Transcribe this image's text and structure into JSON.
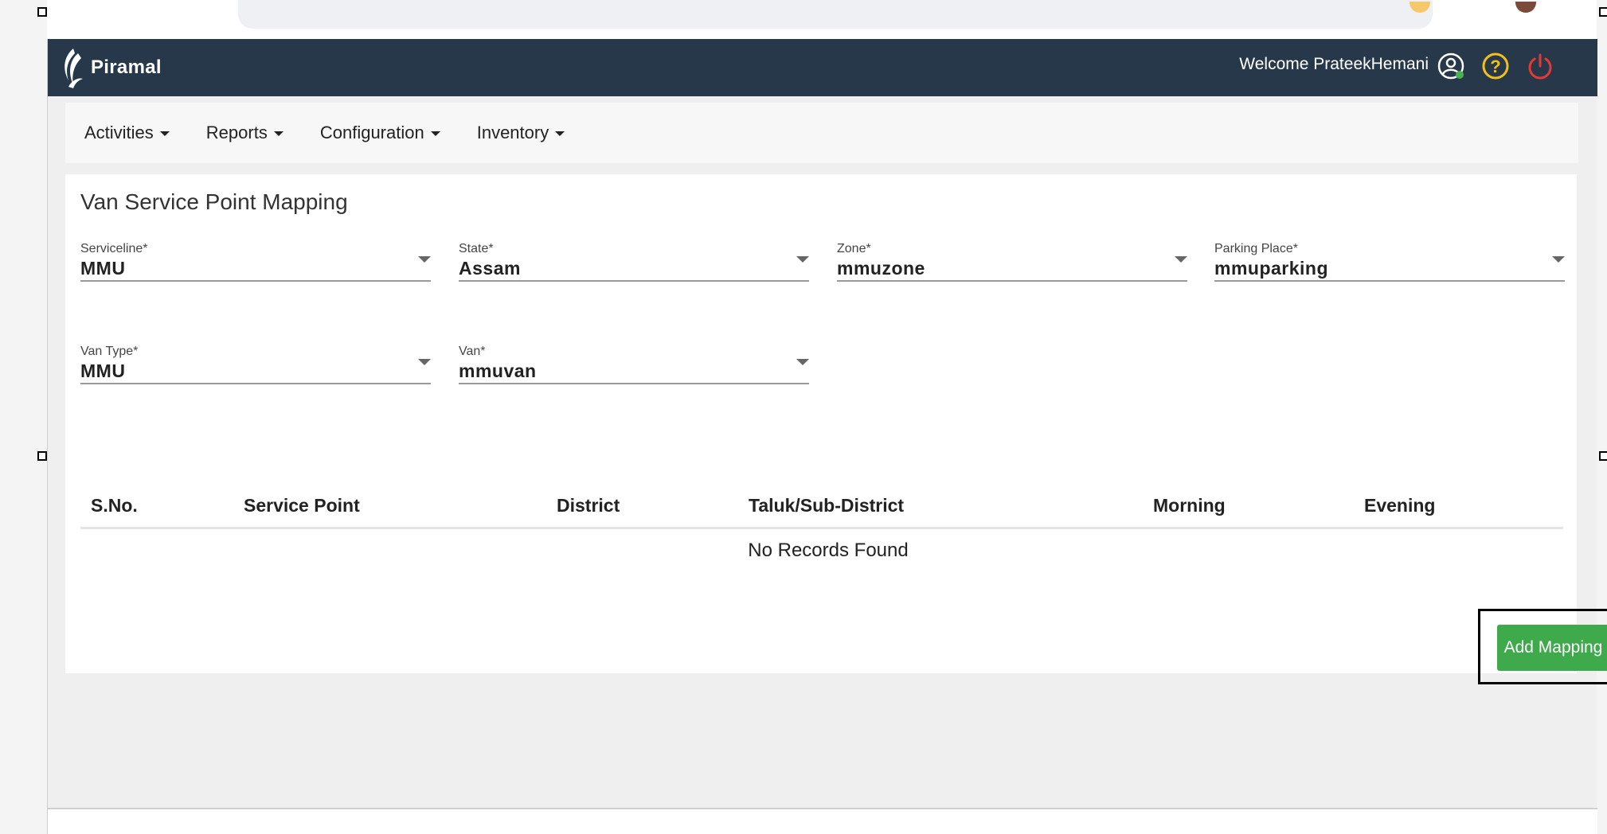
{
  "header": {
    "brand": "Piramal",
    "welcome": "Welcome PrateekHemani",
    "icons": [
      "user-circle-icon",
      "help-icon",
      "power-icon"
    ]
  },
  "menu": [
    {
      "label": "Activities"
    },
    {
      "label": "Reports"
    },
    {
      "label": "Configuration"
    },
    {
      "label": "Inventory"
    }
  ],
  "page": {
    "title": "Van Service Point Mapping"
  },
  "form": {
    "serviceline": {
      "label": "Serviceline*",
      "value": "MMU"
    },
    "state": {
      "label": "State*",
      "value": "Assam"
    },
    "zone": {
      "label": "Zone*",
      "value": "mmuzone"
    },
    "parking": {
      "label": "Parking Place*",
      "value": "mmuparking"
    },
    "van_type": {
      "label": "Van Type*",
      "value": "MMU"
    },
    "van": {
      "label": "Van*",
      "value": "mmuvan"
    }
  },
  "table": {
    "columns": [
      "S.No.",
      "Service Point",
      "District",
      "Taluk/Sub-District",
      "Morning",
      "Evening"
    ],
    "empty_message": "No Records Found"
  },
  "actions": {
    "add_mapping": "Add Mapping"
  },
  "colors": {
    "topbar": "#26384a",
    "accent_green": "#3faa4c",
    "help_yellow": "#f2c01a",
    "power_red": "#e53935"
  }
}
